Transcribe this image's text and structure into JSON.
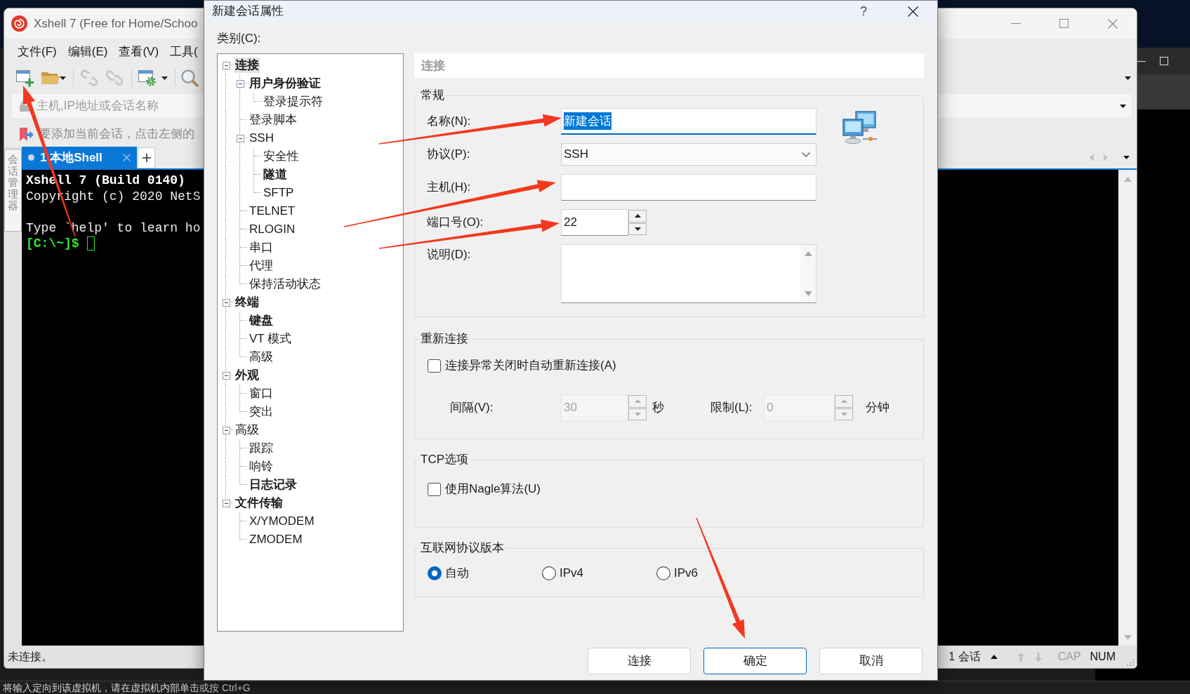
{
  "xshell_window": {
    "title": "Xshell 7 (Free for Home/Schoo",
    "menu": [
      "文件(F)",
      "编辑(E)",
      "查看(V)",
      "工具("
    ],
    "address_bar": {
      "placeholder": "主机,IP地址或会话名称"
    },
    "info_bar": "要添加当前会话，点击左侧的",
    "side_tab": "会话管理器",
    "tabs": [
      {
        "label": "1 本地Shell",
        "selected": true
      }
    ],
    "terminal": [
      {
        "kind": "bold",
        "text": "Xshell 7 (Build 0140)"
      },
      {
        "kind": "plain",
        "text": "Copyright (c) 2020 NetS"
      },
      {
        "kind": "blank"
      },
      {
        "kind": "plain",
        "text": "Type `help' to learn ho"
      },
      {
        "kind": "prompt",
        "text": "[C:\\~]$"
      }
    ],
    "status": "未连接。",
    "sessions": "1 会话",
    "indicators": [
      {
        "label": "CAP",
        "on": false
      },
      {
        "label": "NUM",
        "on": true
      }
    ]
  },
  "dialog": {
    "title": "新建会话属性",
    "help": "?",
    "category_label": "类别(C):",
    "tree": [
      {
        "label": "连接",
        "bold": true,
        "selected": true,
        "expanded": true,
        "children": [
          {
            "label": "用户身份验证",
            "bold": true,
            "selected": false,
            "expanded": true,
            "children": [
              {
                "label": "登录提示符",
                "bold": false,
                "selected": false
              }
            ]
          },
          {
            "label": "登录脚本",
            "bold": false,
            "selected": false
          },
          {
            "label": "SSH",
            "bold": false,
            "selected": false,
            "expanded": true,
            "children": [
              {
                "label": "安全性",
                "bold": false,
                "selected": false
              },
              {
                "label": "隧道",
                "bold": true,
                "selected": false
              },
              {
                "label": "SFTP",
                "bold": false,
                "selected": false
              }
            ]
          },
          {
            "label": "TELNET",
            "bold": false,
            "selected": false
          },
          {
            "label": "RLOGIN",
            "bold": false,
            "selected": false
          },
          {
            "label": "串口",
            "bold": false,
            "selected": false
          },
          {
            "label": "代理",
            "bold": false,
            "selected": false
          },
          {
            "label": "保持活动状态",
            "bold": false,
            "selected": false
          }
        ]
      },
      {
        "label": "终端",
        "bold": true,
        "selected": false,
        "expanded": true,
        "children": [
          {
            "label": "键盘",
            "bold": true,
            "selected": false
          },
          {
            "label": "VT 模式",
            "bold": false,
            "selected": false
          },
          {
            "label": "高级",
            "bold": false,
            "selected": false
          }
        ]
      },
      {
        "label": "外观",
        "bold": true,
        "selected": false,
        "expanded": true,
        "children": [
          {
            "label": "窗口",
            "bold": false,
            "selected": false
          },
          {
            "label": "突出",
            "bold": false,
            "selected": false
          }
        ]
      },
      {
        "label": "高级",
        "bold": false,
        "selected": false,
        "expanded": true,
        "children": [
          {
            "label": "跟踪",
            "bold": false,
            "selected": false
          },
          {
            "label": "响铃",
            "bold": false,
            "selected": false
          },
          {
            "label": "日志记录",
            "bold": true,
            "selected": false
          }
        ]
      },
      {
        "label": "文件传输",
        "bold": true,
        "selected": false,
        "expanded": true,
        "children": [
          {
            "label": "X/YMODEM",
            "bold": false,
            "selected": false
          },
          {
            "label": "ZMODEM",
            "bold": false,
            "selected": false
          }
        ]
      }
    ],
    "section_title": "连接",
    "general": {
      "title": "常规",
      "fields": [
        {
          "kind": "text",
          "label": "名称(N):",
          "value": "新建会话",
          "focused": true,
          "value_selected": true
        },
        {
          "kind": "select",
          "label": "协议(P):",
          "value": "SSH",
          "focused": false
        },
        {
          "kind": "text",
          "label": "主机(H):",
          "focused": false
        },
        {
          "kind": "spin",
          "label": "端口号(O):",
          "value": "22",
          "focused": false
        },
        {
          "kind": "textarea",
          "label": "说明(D):",
          "focused": false
        }
      ]
    },
    "reconnect": {
      "title": "重新连接",
      "checkbox": {
        "label": "连接异常关闭时自动重新连接(A)",
        "checked": false
      },
      "spins": [
        {
          "label": "间隔(V):",
          "value": "30",
          "unit": "秒",
          "disabled": true
        },
        {
          "label": "限制(L):",
          "value": "0",
          "unit": "分钟",
          "disabled": true
        }
      ]
    },
    "tcp": {
      "title": "TCP选项",
      "checkbox": {
        "label": "使用Nagle算法(U)",
        "checked": false
      }
    },
    "ip_version": {
      "title": "互联网协议版本",
      "options": [
        {
          "label": "自动",
          "selected": true
        },
        {
          "label": "IPv4",
          "selected": false
        },
        {
          "label": "IPv6",
          "selected": false
        }
      ]
    },
    "buttons": [
      {
        "label": "连接",
        "default": false
      },
      {
        "label": "确定",
        "default": true
      },
      {
        "label": "取消",
        "default": false
      }
    ]
  },
  "vm_hint": "将输入定向到该虚拟机，请在虚拟机内部单击或按 Ctrl+G"
}
